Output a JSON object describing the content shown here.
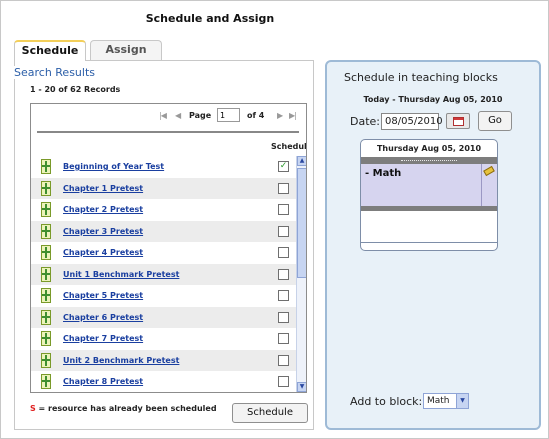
{
  "page": {
    "title": "Schedule and Assign"
  },
  "tabs": [
    {
      "label": "Schedule",
      "active": true
    },
    {
      "label": "Assign",
      "active": false
    }
  ],
  "search": {
    "heading": "Search Results",
    "records": "1 - 20 of 62 Records",
    "pager": {
      "first": "|◀",
      "prev": "◀",
      "page_label": "Page",
      "page_value": "1",
      "of_label": "of 4",
      "next": "▶",
      "last": "▶|"
    },
    "column_header": "Schedule",
    "rows": [
      {
        "title": "Beginning of Year Test",
        "checked": true
      },
      {
        "title": "Chapter 1 Pretest",
        "checked": false
      },
      {
        "title": "Chapter 2 Pretest",
        "checked": false
      },
      {
        "title": "Chapter 3 Pretest",
        "checked": false
      },
      {
        "title": "Chapter 4 Pretest",
        "checked": false
      },
      {
        "title": "Unit 1 Benchmark Pretest",
        "checked": false
      },
      {
        "title": "Chapter 5 Pretest",
        "checked": false
      },
      {
        "title": "Chapter 6 Pretest",
        "checked": false
      },
      {
        "title": "Chapter 7 Pretest",
        "checked": false
      },
      {
        "title": "Unit 2 Benchmark Pretest",
        "checked": false
      },
      {
        "title": "Chapter 8 Pretest",
        "checked": false
      }
    ],
    "legend_marker": "S",
    "legend_text": " = resource has already been scheduled",
    "schedule_button": "Schedule"
  },
  "blocks": {
    "heading": "Schedule in teaching blocks",
    "today": "Today - Thursday Aug 05, 2010",
    "date_label": "Date:",
    "date_value": "08/05/2010",
    "go_button": "Go",
    "day_title": "Thursday Aug 05, 2010",
    "block_name": "- Math",
    "add_label": "Add to block:",
    "add_value": "Math"
  },
  "icons": {
    "resource": "resource-icon",
    "calendar": "calendar-icon",
    "edit": "pencil-icon"
  },
  "colors": {
    "link": "#1a3fa0",
    "accent_tab": "#f3cf5a",
    "panel_bg": "#e8f1f8",
    "block_bg": "#d6d4ef",
    "scheduled_marker": "#e02020"
  }
}
